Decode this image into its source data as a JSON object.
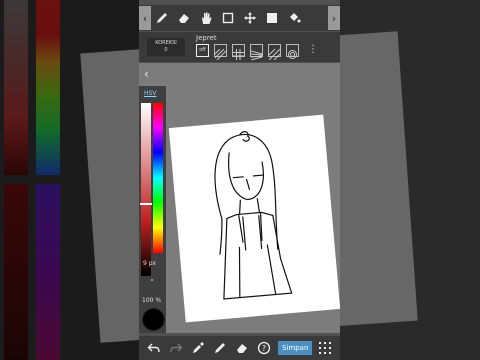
{
  "toolbar": {
    "icons": [
      "pen-icon",
      "eraser-icon",
      "hand-icon",
      "select-rect-icon",
      "move-icon",
      "fill-color-icon",
      "bucket-icon"
    ],
    "arrow_left": "‹",
    "arrow_right": "›"
  },
  "sub_toolbar": {
    "correction_label": "KOREKSI",
    "correction_value": "0",
    "snap_label": "Jepret",
    "snap_off_label": "off"
  },
  "color_panel": {
    "mode_label": "HSV",
    "brush_size": "9 px",
    "opacity": "100 %",
    "current_color": "#000000"
  },
  "bottom_toolbar": {
    "save_label": "Simpan"
  },
  "colors": {
    "accent": "#4a8fc0",
    "toolbar_bg": "#3a3a3a",
    "canvas_bg": "#7c7c7c"
  }
}
